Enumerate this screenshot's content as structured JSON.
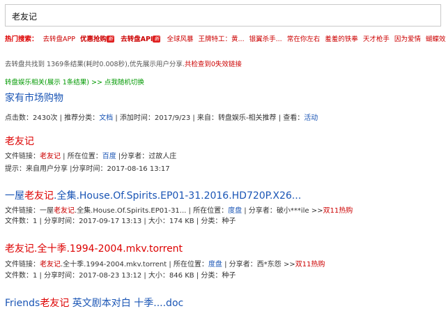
{
  "search": {
    "value": "老友记"
  },
  "hot": {
    "label": "热门搜索：",
    "items": [
      {
        "text": "去转盘APP",
        "tag": ""
      },
      {
        "text": "优惠抢购",
        "tag": "新"
      },
      {
        "text": "去转盘API",
        "tag": "新"
      },
      {
        "text": "全球风暴",
        "tag": ""
      },
      {
        "text": "王牌特工：黄...",
        "tag": ""
      },
      {
        "text": "银翼杀手...",
        "tag": ""
      },
      {
        "text": "常在你左右",
        "tag": ""
      },
      {
        "text": "羞羞的铁拳",
        "tag": ""
      },
      {
        "text": "天才枪手",
        "tag": ""
      },
      {
        "text": "因为爱情",
        "tag": ""
      },
      {
        "text": "蝴蝶效应",
        "tag": ""
      }
    ]
  },
  "summary": {
    "text": "去转盘共找到 1369条结果(耗时0.008秒),优先展示用户分享.",
    "invalid": "共检查到0失效链接"
  },
  "related": {
    "text": "转盘娱乐相关(展示 1条结果) >> 点我随机切换"
  },
  "results": [
    {
      "title_pre": "家有市场购物",
      "title_hl": "",
      "title_post": "",
      "line1": {
        "clicks_label": "点击数：",
        "clicks": "2430次",
        "category_label": " | 推荐分类：",
        "category": "文档",
        "added_label": " | 添加时间：",
        "added": "2017/9/23",
        "source_label": " | 来自：",
        "source": "转盘娱乐-相关推荐",
        "view_label": " | 查看：",
        "view": "活动"
      }
    },
    {
      "title_pre": "",
      "title_hl": "老友记",
      "title_post": "",
      "line1": {
        "link_label": "文件链接：",
        "link_hl": "老友记",
        "loc_label": " | 所在位置：",
        "loc": "百度",
        "sharer_label": " |分享者：",
        "sharer": "过故人庄"
      },
      "line2": {
        "text": "提示：来自用户分享 |分享时间：2017-08-16 13:17"
      }
    },
    {
      "title_pre": "一屋",
      "title_hl": "老友记",
      "title_post": ".全集.House.Of.Spirits.EP01-31.2016.HD720P.X26...",
      "line1": {
        "link_label": "文件链接：一屋",
        "link_hl": "老友记",
        "link_post": ".全集.House.Of.Spirits.EP01-31...",
        "loc_label": " | 所在位置：",
        "loc": "度盘",
        "sharer_label": "  | 分享者：",
        "sharer": "破小***ile >>",
        "promo": "双11热购"
      },
      "line2": {
        "text": "文件数：1 | 分享时间：2017-09-17 13:13 | 大小：174 KB | 分类：种子"
      }
    },
    {
      "title_pre": "",
      "title_hl": "老友记",
      "title_post": ".全十季.1994-2004.mkv.torrent",
      "line1": {
        "link_label": "文件链接：",
        "link_hl": "老友记",
        "link_post": ".全十季.1994-2004.mkv.torrent",
        "loc_label": " | 所在位置：",
        "loc": "度盘",
        "sharer_label": "  | 分享者：",
        "sharer": "西*东怨 >>",
        "promo": "双11热购"
      },
      "line2": {
        "text": "文件数：1 | 分享时间：2017-08-23 13:12 | 大小：846 KB | 分类：种子"
      }
    },
    {
      "title_pre": "Friends",
      "title_hl": "老友记",
      "title_post": " 英文剧本对白 十季....doc"
    }
  ]
}
